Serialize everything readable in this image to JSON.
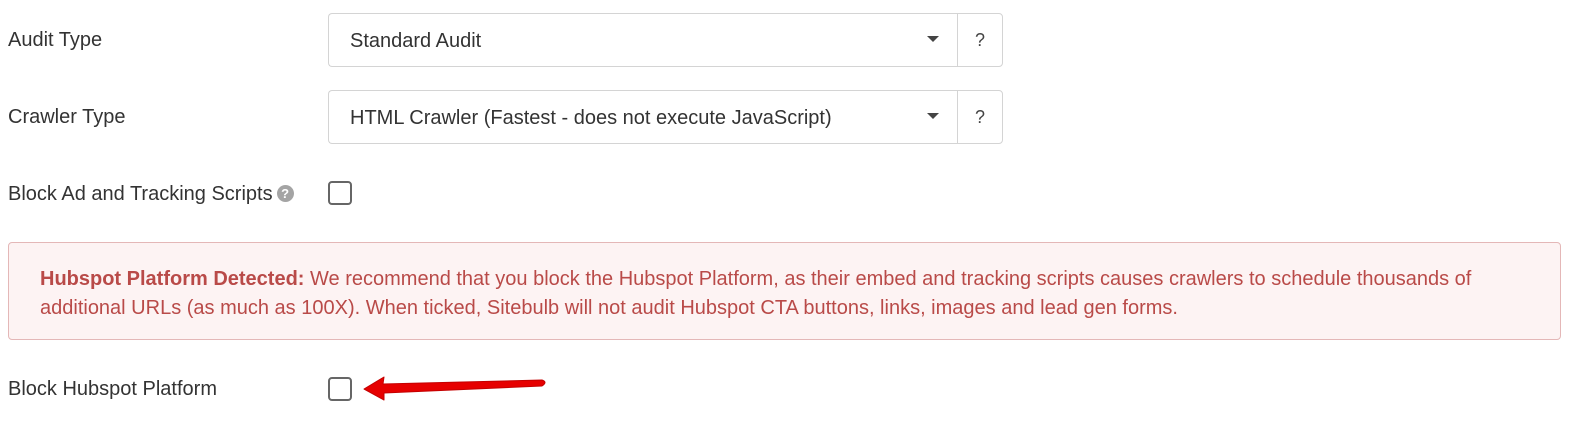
{
  "audit_type": {
    "label": "Audit Type",
    "selected": "Standard Audit",
    "help_label": "?"
  },
  "crawler_type": {
    "label": "Crawler Type",
    "selected": "HTML Crawler (Fastest - does not execute JavaScript)",
    "help_label": "?"
  },
  "block_ad_tracking": {
    "label": "Block Ad and Tracking Scripts",
    "help_icon": "question-circle-icon",
    "help_glyph": "?",
    "checked": false
  },
  "alert": {
    "title": "Hubspot Platform Detected:",
    "message": " We recommend that you block the Hubspot Platform, as their embed and tracking scripts causes crawlers to schedule thousands of additional URLs (as much as 100X). When ticked, Sitebulb will not audit Hubspot CTA buttons, links, images and lead gen forms.",
    "text_color": "#b94a48",
    "bg_color": "#fdf3f3"
  },
  "block_hubspot": {
    "label": "Block Hubspot Platform",
    "checked": false
  },
  "annotation": {
    "icon": "red-arrow-icon",
    "color": "#e60000"
  }
}
